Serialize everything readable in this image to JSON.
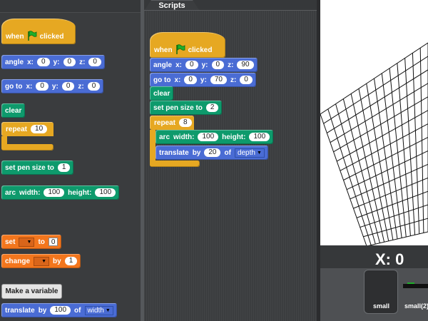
{
  "scripts_tab": {
    "label": "Scripts"
  },
  "palette": {
    "hat": {
      "when": "when",
      "clicked": "clicked"
    },
    "angle": {
      "label": "angle",
      "x_label": "x:",
      "x": "0",
      "y_label": "y:",
      "y": "0",
      "z_label": "z:",
      "z": "0"
    },
    "goto": {
      "label": "go to",
      "x_label": "x:",
      "x": "0",
      "y_label": "y:",
      "y": "0",
      "z_label": "z:",
      "z": "0"
    },
    "clear": {
      "label": "clear"
    },
    "repeat": {
      "label": "repeat",
      "count": "10"
    },
    "pen_size": {
      "label": "set pen size to",
      "value": "1"
    },
    "arc": {
      "label": "arc",
      "width_label": "width:",
      "width": "100",
      "height_label": "height:",
      "height": "100"
    },
    "set_var": {
      "label": "set",
      "to_label": "to",
      "value": "0"
    },
    "change_var": {
      "label": "change",
      "by_label": "by",
      "value": "1"
    },
    "make_variable": "Make a variable",
    "translate": {
      "label": "translate",
      "by_label": "by",
      "value": "100",
      "of_label": "of",
      "dimension": "width"
    }
  },
  "script": {
    "hat": {
      "when": "when",
      "clicked": "clicked"
    },
    "angle": {
      "label": "angle",
      "x_label": "x:",
      "x": "0",
      "y_label": "y:",
      "y": "0",
      "z_label": "z:",
      "z": "90"
    },
    "goto": {
      "label": "go to",
      "x_label": "x:",
      "x": "0",
      "y_label": "y:",
      "y": "70",
      "z_label": "z:",
      "z": "0"
    },
    "clear": {
      "label": "clear"
    },
    "pen_size": {
      "label": "set pen size to",
      "value": "2"
    },
    "repeat": {
      "label": "repeat",
      "count": "8"
    },
    "arc": {
      "label": "arc",
      "width_label": "width:",
      "width": "100",
      "height_label": "height:",
      "height": "100"
    },
    "translate": {
      "label": "translate",
      "by_label": "by",
      "value": "20",
      "of_label": "of",
      "dimension": "depth"
    }
  },
  "stage": {
    "x_readout": "X: 0"
  },
  "sprites": [
    {
      "name": "small"
    },
    {
      "name": "small(2)"
    }
  ],
  "colors": {
    "motion": "#4a6cd4",
    "pen": "#0e9a6c",
    "control": "#e6a822",
    "variables": "#f3761d",
    "flag": "#1fae2a"
  }
}
